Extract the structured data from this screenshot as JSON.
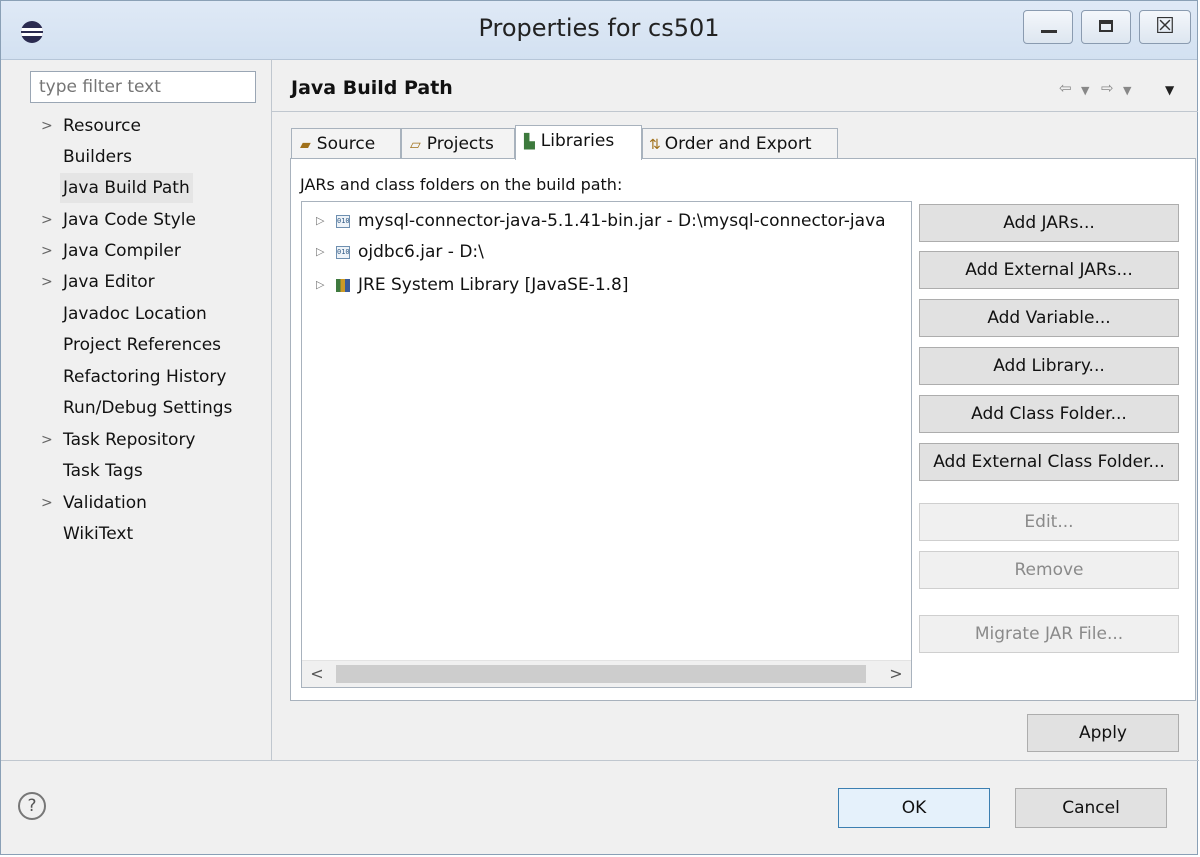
{
  "window": {
    "title": "Properties for cs501",
    "close_glyph": "☒"
  },
  "sidebar": {
    "filter_placeholder": "type filter text",
    "items": [
      {
        "label": "Resource",
        "expandable": true,
        "selected": false
      },
      {
        "label": "Builders",
        "expandable": false,
        "selected": false
      },
      {
        "label": "Java Build Path",
        "expandable": false,
        "selected": true
      },
      {
        "label": "Java Code Style",
        "expandable": true,
        "selected": false
      },
      {
        "label": "Java Compiler",
        "expandable": true,
        "selected": false
      },
      {
        "label": "Java Editor",
        "expandable": true,
        "selected": false
      },
      {
        "label": "Javadoc Location",
        "expandable": false,
        "selected": false
      },
      {
        "label": "Project References",
        "expandable": false,
        "selected": false
      },
      {
        "label": "Refactoring History",
        "expandable": false,
        "selected": false
      },
      {
        "label": "Run/Debug Settings",
        "expandable": false,
        "selected": false
      },
      {
        "label": "Task Repository",
        "expandable": true,
        "selected": false
      },
      {
        "label": "Task Tags",
        "expandable": false,
        "selected": false
      },
      {
        "label": "Validation",
        "expandable": true,
        "selected": false
      },
      {
        "label": "WikiText",
        "expandable": false,
        "selected": false
      }
    ]
  },
  "main": {
    "title": "Java Build Path",
    "tabs": [
      {
        "label": "Source",
        "icon": "source-folder-icon",
        "active": false
      },
      {
        "label": "Projects",
        "icon": "projects-folder-icon",
        "active": false
      },
      {
        "label": "Libraries",
        "icon": "libraries-icon",
        "active": true
      },
      {
        "label": "Order and Export",
        "icon": "order-export-icon",
        "active": false
      }
    ],
    "panel_label": "JARs and class folders on the build path:",
    "tree": [
      {
        "label": "mysql-connector-java-5.1.41-bin.jar - D:\\mysql-connector-java",
        "icon": "jar-icon"
      },
      {
        "label": "ojdbc6.jar - D:\\",
        "icon": "jar-icon"
      },
      {
        "label": "JRE System Library [JavaSE-1.8]",
        "icon": "library-icon"
      }
    ],
    "buttons": [
      {
        "label": "Add JARs...",
        "enabled": true
      },
      {
        "label": "Add External JARs...",
        "enabled": true
      },
      {
        "label": "Add Variable...",
        "enabled": true
      },
      {
        "label": "Add Library...",
        "enabled": true
      },
      {
        "label": "Add Class Folder...",
        "enabled": true
      },
      {
        "label": "Add External Class Folder...",
        "enabled": true
      },
      {
        "label": "Edit...",
        "enabled": false
      },
      {
        "label": "Remove",
        "enabled": false
      },
      {
        "label": "Migrate JAR File...",
        "enabled": false
      }
    ],
    "apply_label": "Apply"
  },
  "footer": {
    "help_glyph": "?",
    "ok_label": "OK",
    "cancel_label": "Cancel"
  },
  "colors": {
    "titlebar": "#d8e4f2",
    "selected_nav": "#e5e5e5",
    "default_button_border": "#3c7fb1"
  }
}
